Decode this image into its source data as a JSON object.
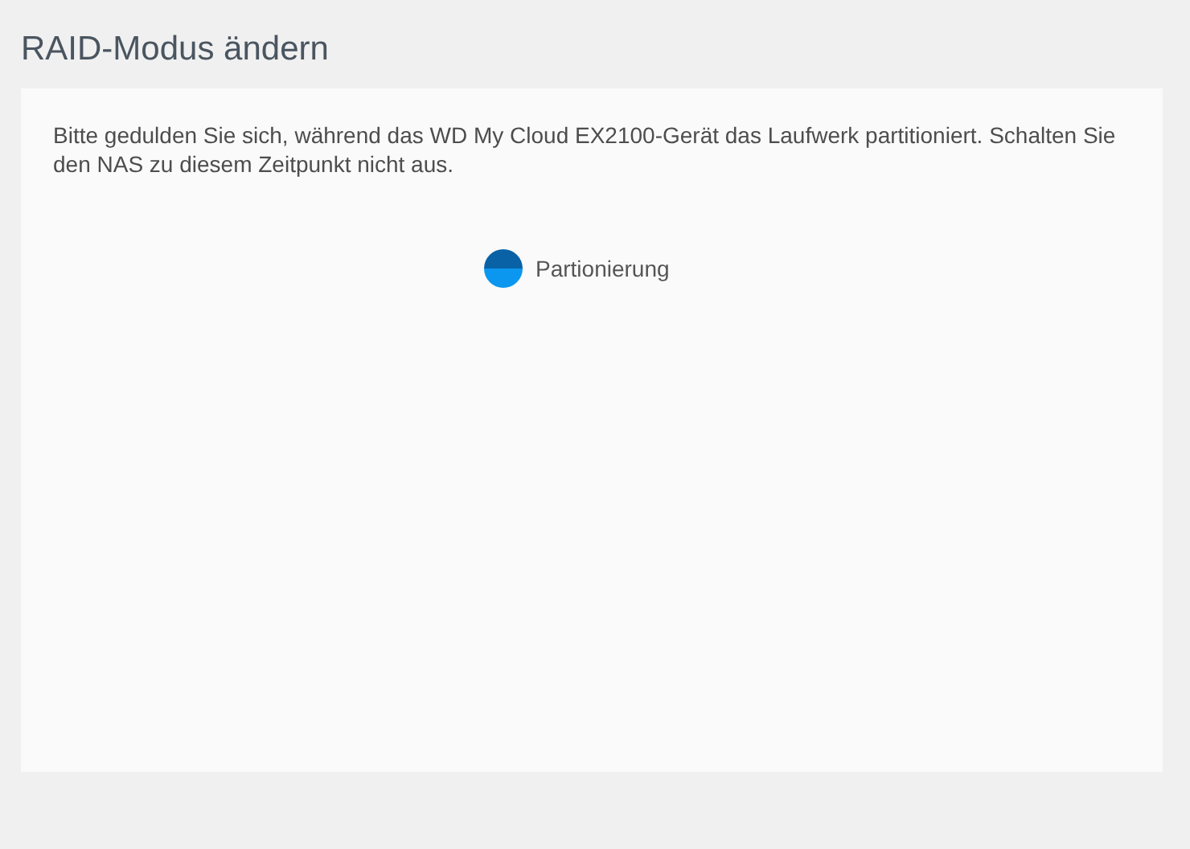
{
  "title": "RAID-Modus ändern",
  "message": "Bitte gedulden Sie sich, während das WD My Cloud EX2100-Gerät das Laufwerk partitioniert. Schalten Sie den NAS zu diesem Zeitpunkt nicht aus.",
  "status": {
    "label": "Partionierung"
  }
}
